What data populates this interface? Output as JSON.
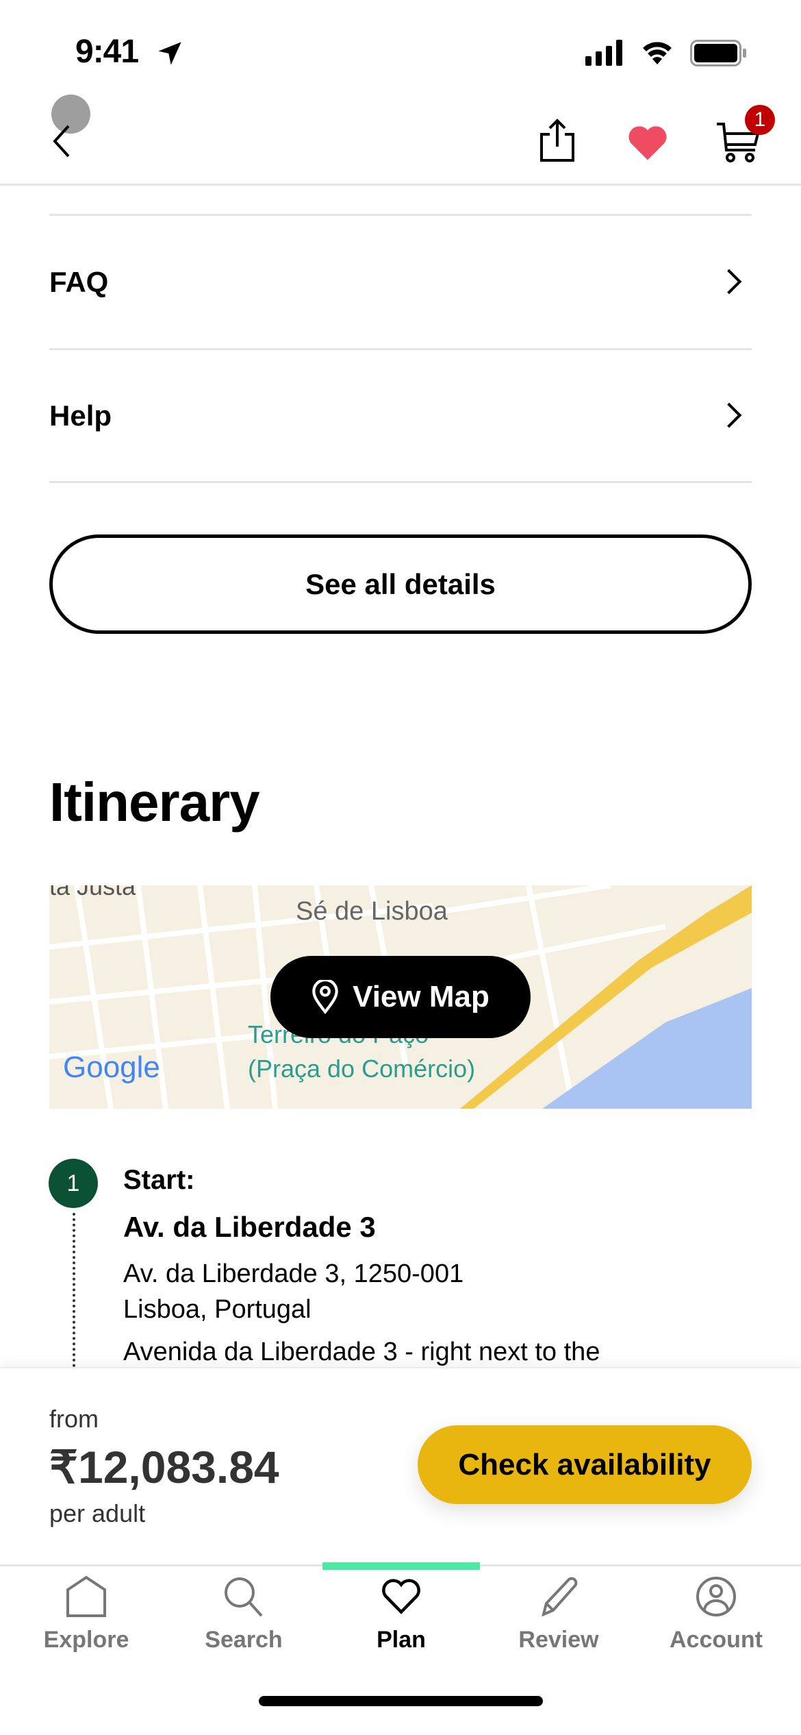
{
  "status_bar": {
    "time": "9:41"
  },
  "nav": {
    "cart_count": "1"
  },
  "rows": [
    {
      "label": "FAQ"
    },
    {
      "label": "Help"
    }
  ],
  "see_all_label": "See all details",
  "itinerary": {
    "title": "Itinerary",
    "map": {
      "button_label": "View Map",
      "labels": [
        "ta Justa",
        "Sé de Lisboa",
        "Terreiro do Paço",
        "(Praça do Comércio)"
      ],
      "attribution": "Google"
    },
    "step": {
      "number": "1",
      "kind": "Start:",
      "name": "Av. da Liberdade 3",
      "address_line1": "Av. da Liberdade 3, 1250-001",
      "address_line2": "Lisboa, Portugal",
      "description": "Avenida da Liberdade 3 - right next to the"
    }
  },
  "booking": {
    "from_label": "from",
    "price": "₹12,083.84",
    "per_label": "per adult",
    "cta_label": "Check availability"
  },
  "tabs": [
    {
      "label": "Explore"
    },
    {
      "label": "Search"
    },
    {
      "label": "Plan",
      "active": true
    },
    {
      "label": "Review"
    },
    {
      "label": "Account"
    }
  ],
  "colors": {
    "accent": "#e9b50f",
    "step": "#0b5235",
    "tab_indicator": "#4ee8a5",
    "heart": "#ef4b63",
    "badge": "#c00000"
  }
}
